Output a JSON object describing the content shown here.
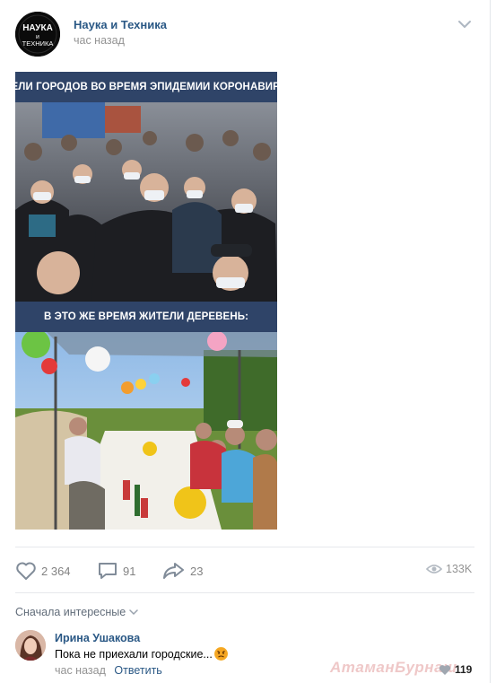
{
  "post": {
    "group_name": "Наука и Техника",
    "time": "час назад",
    "logo_text_top": "НАУКА",
    "logo_text_mid": "и",
    "logo_text_bottom": "ТЕХНИКА",
    "image": {
      "top_caption": "Жители городов во время эпидемии коронавируса:",
      "bottom_caption": "В это же время жители деревень:"
    }
  },
  "actions": {
    "likes": "2 364",
    "comments": "91",
    "shares": "23",
    "views": "133K"
  },
  "comments_section": {
    "sort_label": "Сначала интересные",
    "comment": {
      "author": "Ирина Ушакова",
      "text": "Пока не приехали городские...",
      "time": "час назад",
      "reply_label": "Ответить",
      "likes": "119"
    }
  },
  "watermark": "АтаманБурнаш",
  "colors": {
    "link": "#2a5885",
    "muted": "#939393",
    "banner": "#2f4468",
    "divider": "#e7e8ec"
  },
  "icons": [
    "more-chevron-icon",
    "heart-icon",
    "comment-icon",
    "share-icon",
    "eye-icon",
    "chevron-down-icon",
    "small-heart-icon",
    "angry-emoji-icon"
  ]
}
